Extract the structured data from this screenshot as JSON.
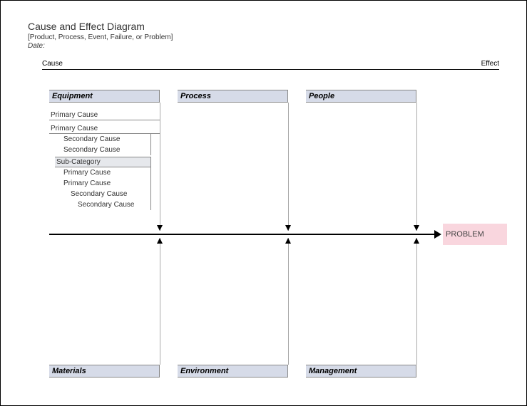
{
  "header": {
    "title": "Cause and Effect Diagram",
    "subtitle": "[Product, Process, Event, Failure, or Problem]",
    "date_label": "Date:",
    "cause_label": "Cause",
    "effect_label": "Effect"
  },
  "categories": {
    "equipment": "Equipment",
    "process": "Process",
    "people": "People",
    "materials": "Materials",
    "environment": "Environment",
    "management": "Management"
  },
  "equipment_detail": {
    "primary1": "Primary Cause",
    "primary2": "Primary Cause",
    "secondary1": "Secondary Cause",
    "secondary2": "Secondary Cause",
    "subcat": "Sub-Category",
    "primary3": "Primary Cause",
    "primary4": "Primary Cause",
    "secondary3": "Secondary Cause",
    "secondary4": "Secondary Cause"
  },
  "effect": {
    "label": "PROBLEM"
  }
}
